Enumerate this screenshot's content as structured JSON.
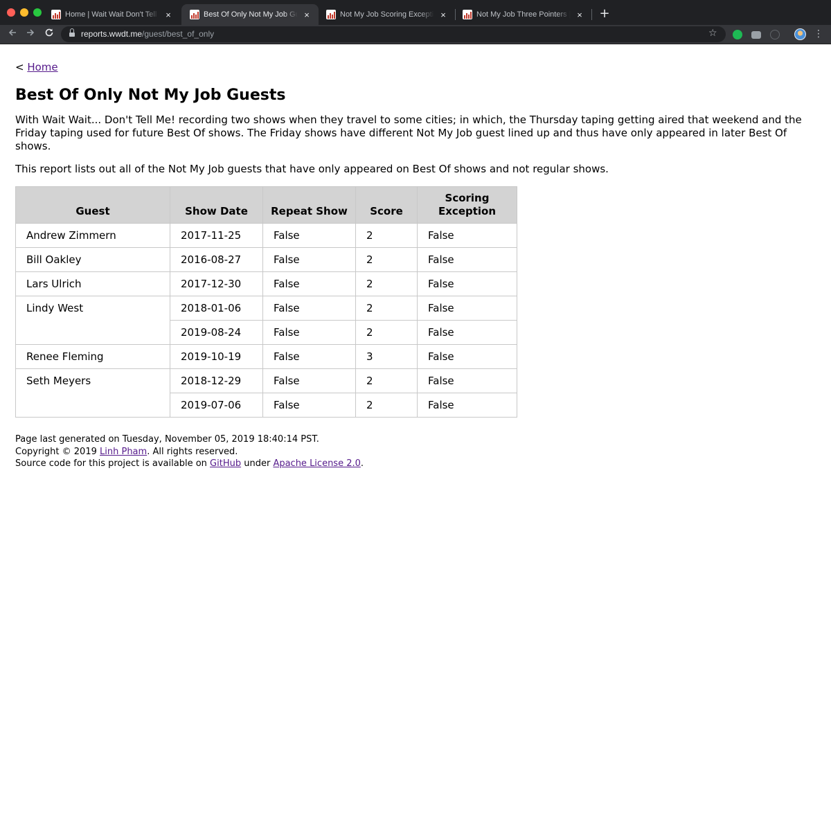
{
  "browser": {
    "tabs": [
      {
        "title": "Home | Wait Wait Don't Tell Me",
        "active": false
      },
      {
        "title": "Best Of Only Not My Job Guests",
        "active": true
      },
      {
        "title": "Not My Job Scoring Exceptions",
        "active": false
      },
      {
        "title": "Not My Job Three Pointers | Wait Wait",
        "active": false
      }
    ],
    "tab_close_glyph": "×",
    "new_tab_glyph": "+",
    "url_host": "reports.wwdt.me",
    "url_path": "/guest/best_of_only",
    "icons": [
      "back-arrow-icon",
      "forward-arrow-icon",
      "reload-icon",
      "lock-icon",
      "star-icon",
      "extension-icon",
      "camera-icon",
      "info-icon",
      "profile-avatar",
      "menu-dots-icon"
    ],
    "colors": {
      "chrome_bg": "#202124",
      "toolbar_bg": "#35363a"
    }
  },
  "page": {
    "breadcrumb_prefix": "< ",
    "breadcrumb_link": "Home",
    "title": "Best Of Only Not My Job Guests",
    "intro_paragraph": "With Wait Wait... Don't Tell Me! recording two shows when they travel to some cities; in which, the Thursday taping getting aired that weekend and the Friday taping used for future Best Of shows. The Friday shows have different Not My Job guest lined up and thus have only appeared in later Best Of shows.",
    "description_paragraph": "This report lists out all of the Not My Job guests that have only appeared on Best Of shows and not regular shows.",
    "link_color": "#551a8b"
  },
  "table": {
    "headers": [
      "Guest",
      "Show Date",
      "Repeat Show",
      "Score",
      "Scoring Exception"
    ],
    "guests": [
      {
        "name": "Andrew Zimmern",
        "shows": [
          {
            "date": "2017-11-25",
            "repeat": "False",
            "score": "2",
            "exception": "False"
          }
        ]
      },
      {
        "name": "Bill Oakley",
        "shows": [
          {
            "date": "2016-08-27",
            "repeat": "False",
            "score": "2",
            "exception": "False"
          }
        ]
      },
      {
        "name": "Lars Ulrich",
        "shows": [
          {
            "date": "2017-12-30",
            "repeat": "False",
            "score": "2",
            "exception": "False"
          }
        ]
      },
      {
        "name": "Lindy West",
        "shows": [
          {
            "date": "2018-01-06",
            "repeat": "False",
            "score": "2",
            "exception": "False"
          },
          {
            "date": "2019-08-24",
            "repeat": "False",
            "score": "2",
            "exception": "False"
          }
        ]
      },
      {
        "name": "Renee Fleming",
        "shows": [
          {
            "date": "2019-10-19",
            "repeat": "False",
            "score": "3",
            "exception": "False"
          }
        ]
      },
      {
        "name": "Seth Meyers",
        "shows": [
          {
            "date": "2018-12-29",
            "repeat": "False",
            "score": "2",
            "exception": "False"
          },
          {
            "date": "2019-07-06",
            "repeat": "False",
            "score": "2",
            "exception": "False"
          }
        ]
      }
    ],
    "header_bg": "#d3d3d3"
  },
  "footer": {
    "generated": "Page last generated on Tuesday, November 05, 2019 18:40:14 PST.",
    "copyright_prefix": "Copyright © 2019 ",
    "author_link": "Linh Pham",
    "copyright_suffix": ". All rights reserved.",
    "source_prefix": "Source code for this project is available on ",
    "github_link": "GitHub",
    "source_middle": " under ",
    "license_link": "Apache License 2.0",
    "source_suffix": "."
  }
}
